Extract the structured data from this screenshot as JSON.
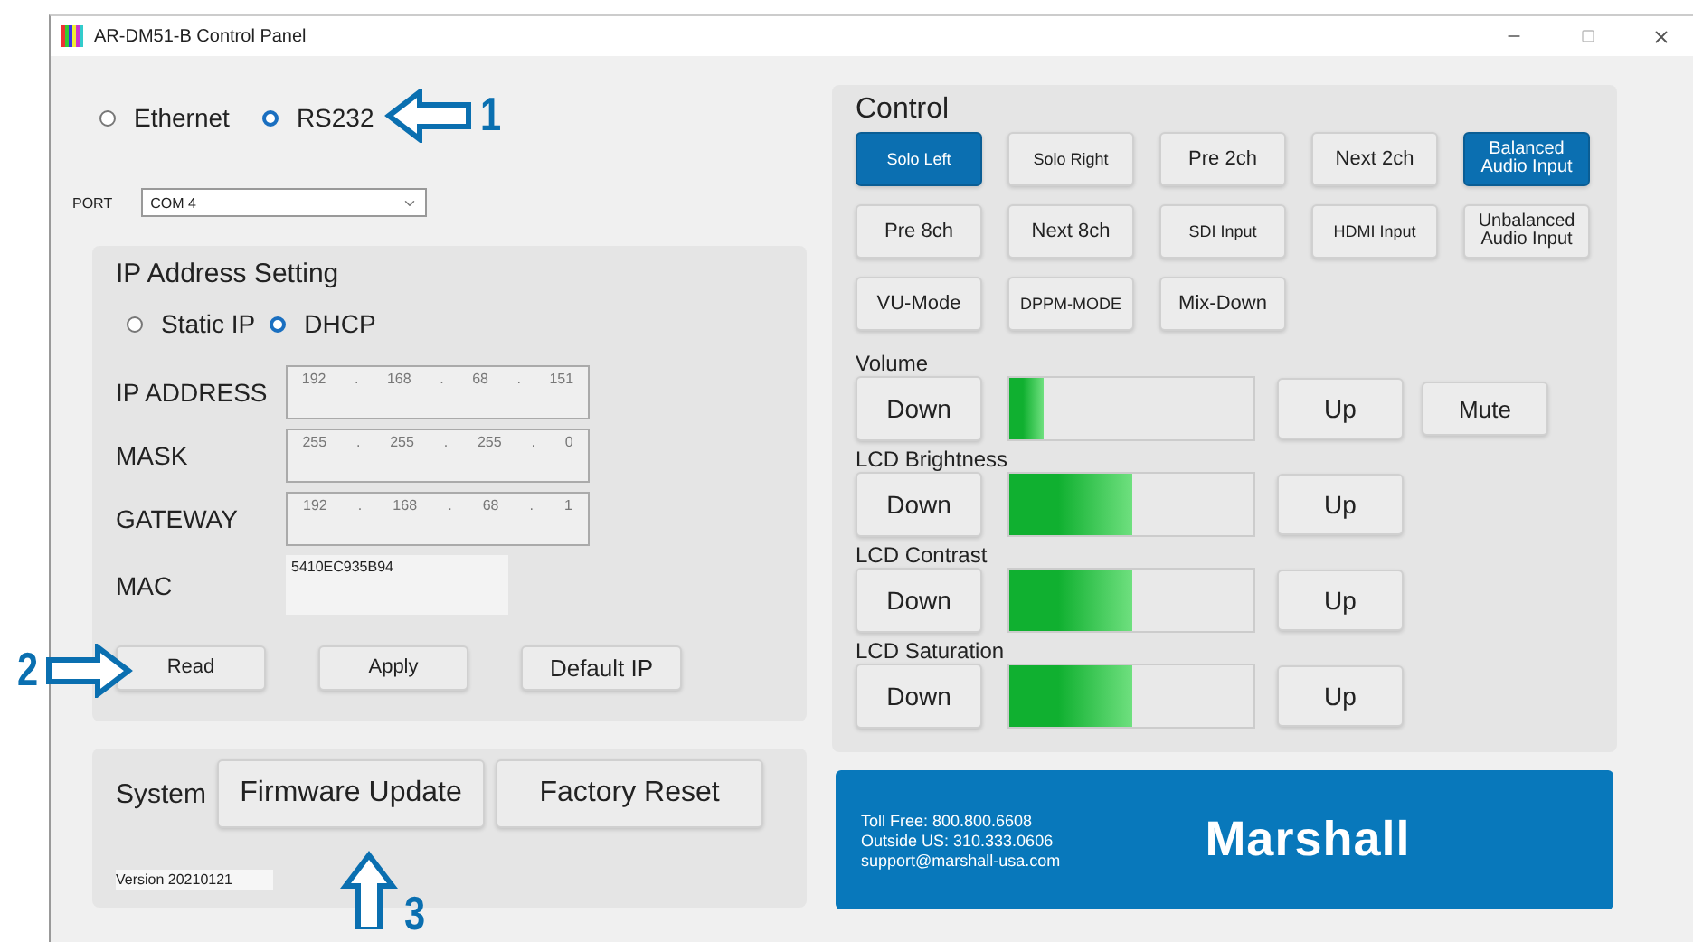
{
  "window": {
    "title": "AR-DM51-B Control Panel"
  },
  "connection": [
    {
      "label": "Ethernet",
      "selected": false
    },
    {
      "label": "RS232",
      "selected": true
    }
  ],
  "port": {
    "label": "PORT",
    "value": "COM 4"
  },
  "ip_settings": {
    "title": "IP Address Setting",
    "mode": [
      {
        "label": "Static IP",
        "selected": false
      },
      {
        "label": "DHCP",
        "selected": true
      }
    ],
    "fields": [
      {
        "label": "IP ADDRESS",
        "octets": [
          "192",
          "168",
          "68",
          "151"
        ],
        "separator": "."
      },
      {
        "label": "MASK",
        "octets": [
          "255",
          "255",
          "255",
          "0"
        ],
        "separator": "."
      },
      {
        "label": "GATEWAY",
        "octets": [
          "192",
          "168",
          "68",
          "1"
        ],
        "separator": "."
      }
    ],
    "mac": {
      "label": "MAC",
      "value": "5410EC935B94"
    },
    "buttons": [
      "Read",
      "Apply",
      "Default IP"
    ]
  },
  "system": {
    "label": "System",
    "buttons": [
      "Firmware Update",
      "Factory Reset"
    ],
    "version": "Version 20210121"
  },
  "control": {
    "title": "Control",
    "buttons": [
      {
        "label": "Solo Left",
        "selected": true
      },
      {
        "label": "Solo Right",
        "selected": false
      },
      {
        "label": "Pre 2ch",
        "selected": false
      },
      {
        "label": "Next 2ch",
        "selected": false
      },
      {
        "label": "Balanced Audio Input",
        "selected": true
      },
      {
        "label": "Pre 8ch",
        "selected": false
      },
      {
        "label": "Next 8ch",
        "selected": false
      },
      {
        "label": "SDI Input",
        "selected": false
      },
      {
        "label": "HDMI Input",
        "selected": false
      },
      {
        "label": "Unbalanced Audio Input",
        "selected": false
      },
      {
        "label": "VU-Mode",
        "selected": false
      },
      {
        "label": "DPPM-MODE",
        "selected": false
      },
      {
        "label": "Mix-Down",
        "selected": false
      }
    ],
    "adjusters": [
      {
        "label": "Volume",
        "down": "Down",
        "up": "Up",
        "level": 0.14,
        "extra": "Mute"
      },
      {
        "label": "LCD Brightness",
        "down": "Down",
        "up": "Up",
        "level": 0.5
      },
      {
        "label": "LCD Contrast",
        "down": "Down",
        "up": "Up",
        "level": 0.5
      },
      {
        "label": "LCD Saturation",
        "down": "Down",
        "up": "Up",
        "level": 0.5
      }
    ]
  },
  "footer": {
    "contact": [
      "Toll Free: 800.800.6608",
      "Outside US: 310.333.0606",
      "support@marshall-usa.com"
    ],
    "logo": "Marshall"
  },
  "callouts": [
    {
      "number": "1",
      "kind": "left"
    },
    {
      "number": "2",
      "kind": "right"
    },
    {
      "number": "3",
      "kind": "up"
    }
  ]
}
